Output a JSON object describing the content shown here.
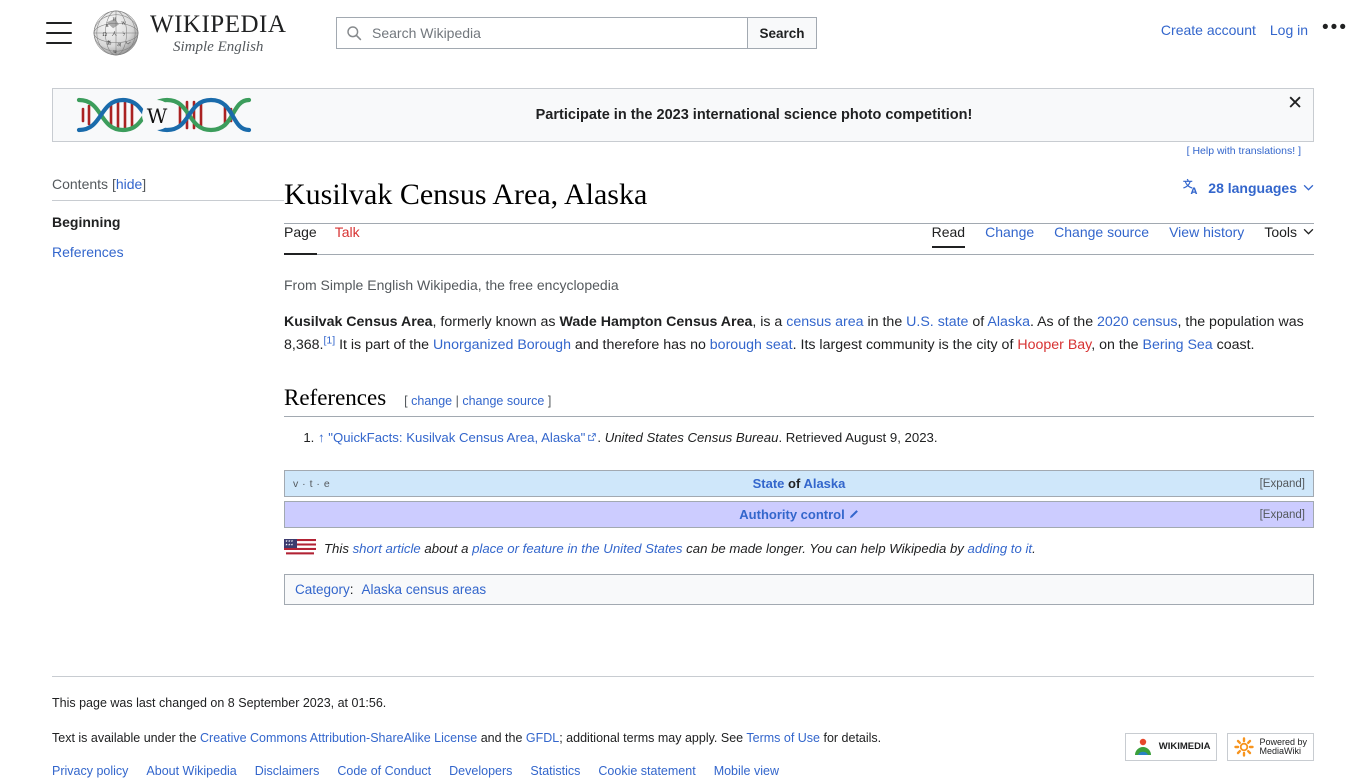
{
  "header": {
    "menu_icon": "hamburger-icon",
    "logo": {
      "wordmark": "WIKIPEDIA",
      "tagline": "Simple English"
    },
    "search": {
      "placeholder": "Search Wikipedia",
      "value": "",
      "button_label": "Search",
      "icon": "search-icon"
    },
    "create_account": "Create account",
    "login": "Log in",
    "more_icon": "ellipsis-icon"
  },
  "banner": {
    "text": "Participate in the 2023 international science photo competition!",
    "help_link": "[ Help with translations! ]",
    "close_icon": "close-icon",
    "logo_icon": "dna-wikipedia-icon",
    "colors": {
      "background": "#f8f9fa",
      "border": "#c8ccd1",
      "strand_blue": "#1a6bab",
      "strand_green": "#3c9d5c",
      "rung_red": "#aa2222"
    }
  },
  "sidebar": {
    "contents_label": "Contents",
    "hide_label": "hide",
    "items": [
      {
        "label": "Beginning",
        "active": true
      },
      {
        "label": "References",
        "active": false
      }
    ]
  },
  "article": {
    "title": "Kusilvak Census Area, Alaska",
    "languages_button": {
      "label": "28 languages",
      "icon": "language-icon",
      "chevron": "chevron-down-icon"
    },
    "namespace_tabs": [
      {
        "label": "Page",
        "selected": true,
        "red": false
      },
      {
        "label": "Talk",
        "selected": false,
        "red": true
      }
    ],
    "view_tabs": [
      {
        "label": "Read",
        "selected": true
      },
      {
        "label": "Change",
        "selected": false
      },
      {
        "label": "Change source",
        "selected": false
      },
      {
        "label": "View history",
        "selected": false
      }
    ],
    "tools_label": "Tools",
    "tagline": "From Simple English Wikipedia, the free encyclopedia",
    "lead": {
      "b1": "Kusilvak Census Area",
      "t1": ", formerly known as ",
      "b2": "Wade Hampton Census Area",
      "t2": ", is a ",
      "l1": "census area",
      "t3": " in the ",
      "l2": "U.S. state",
      "t4": " of ",
      "l3": "Alaska",
      "t5": ". As of the ",
      "l4": "2020 census",
      "t6": ", the population was 8,368.",
      "ref": "[1]",
      "t7": " It is part of the ",
      "l5": "Unorganized Borough",
      "t8": " and therefore has no ",
      "l6": "borough seat",
      "t9": ". Its largest community is the city of ",
      "l7": "Hooper Bay",
      "t10": ", on the ",
      "l8": "Bering Sea",
      "t11": " coast."
    }
  },
  "references": {
    "heading": "References",
    "edit_open": "[",
    "edit_change": "change",
    "edit_pipe": "|",
    "edit_change_source": "change source",
    "edit_close": "]",
    "items": [
      {
        "backlink": "↑",
        "title": "\"QuickFacts: Kusilvak Census Area, Alaska\"",
        "external_icon": "external-link-icon",
        "publisher": "United States Census Bureau",
        "retrieved": ". Retrieved August 9, 2023."
      }
    ]
  },
  "navboxes": [
    {
      "id": "state-of-alaska",
      "vte": "v · t · e",
      "title_prefix": "State",
      "title_middle": " of ",
      "title_suffix": "Alaska",
      "expand": "[Expand]",
      "background": "#cfe7fa"
    },
    {
      "id": "authority-control",
      "vte": "",
      "title_prefix": "Authority control",
      "title_middle": "",
      "title_suffix": "",
      "expand": "[Expand]",
      "background": "#ccccff",
      "pencil_icon": "pencil-icon"
    }
  ],
  "stub": {
    "icon": "us-flag-map-icon",
    "t1": "This ",
    "l1": "short article",
    "t2": " about a ",
    "l2": "place or feature in the United States",
    "t3": " can be made longer. You can help Wikipedia by ",
    "l3": "adding to it",
    "t4": "."
  },
  "category_box": {
    "label": "Category",
    "separator": ":",
    "items": [
      "Alaska census areas"
    ]
  },
  "footer": {
    "last_changed": "This page was last changed on 8 September 2023, at 01:56.",
    "license": {
      "t1": "Text is available under the ",
      "l1": "Creative Commons Attribution-ShareAlike License",
      "t2": " and the ",
      "l2": "GFDL",
      "t3": "; additional terms may apply. See ",
      "l3": "Terms of Use",
      "t4": " for details."
    },
    "links": [
      "Privacy policy",
      "About Wikipedia",
      "Disclaimers",
      "Code of Conduct",
      "Developers",
      "Statistics",
      "Cookie statement",
      "Mobile view"
    ],
    "logos": [
      {
        "name": "wikimedia-foundation-logo",
        "line1": "WIKIMEDIA",
        "line2": ""
      },
      {
        "name": "powered-by-mediawiki-logo",
        "line1": "Powered by",
        "line2": "MediaWiki"
      }
    ]
  }
}
